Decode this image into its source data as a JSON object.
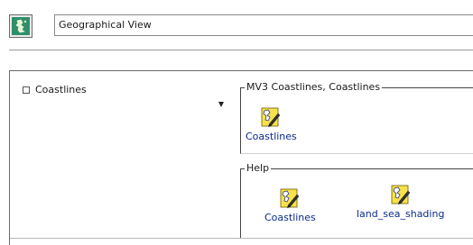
{
  "window": {
    "title": "Geographical View"
  },
  "tree": {
    "items": [
      {
        "label": "Coastlines",
        "checked": false
      }
    ]
  },
  "groups": [
    {
      "title": "MV3 Coastlines, Coastlines",
      "icons": [
        {
          "label": "Coastlines",
          "icon": "coastlines-edit-icon"
        }
      ]
    },
    {
      "title": "Help",
      "icons": [
        {
          "label": "Coastlines",
          "icon": "coastlines-edit-icon"
        },
        {
          "label": "land_sea_shading",
          "icon": "land-sea-shading-edit-icon"
        }
      ]
    }
  ],
  "colors": {
    "icon_label": "#0b2a8a",
    "icon_background": "#f7e24a",
    "app_icon": "#2f8f6a"
  }
}
